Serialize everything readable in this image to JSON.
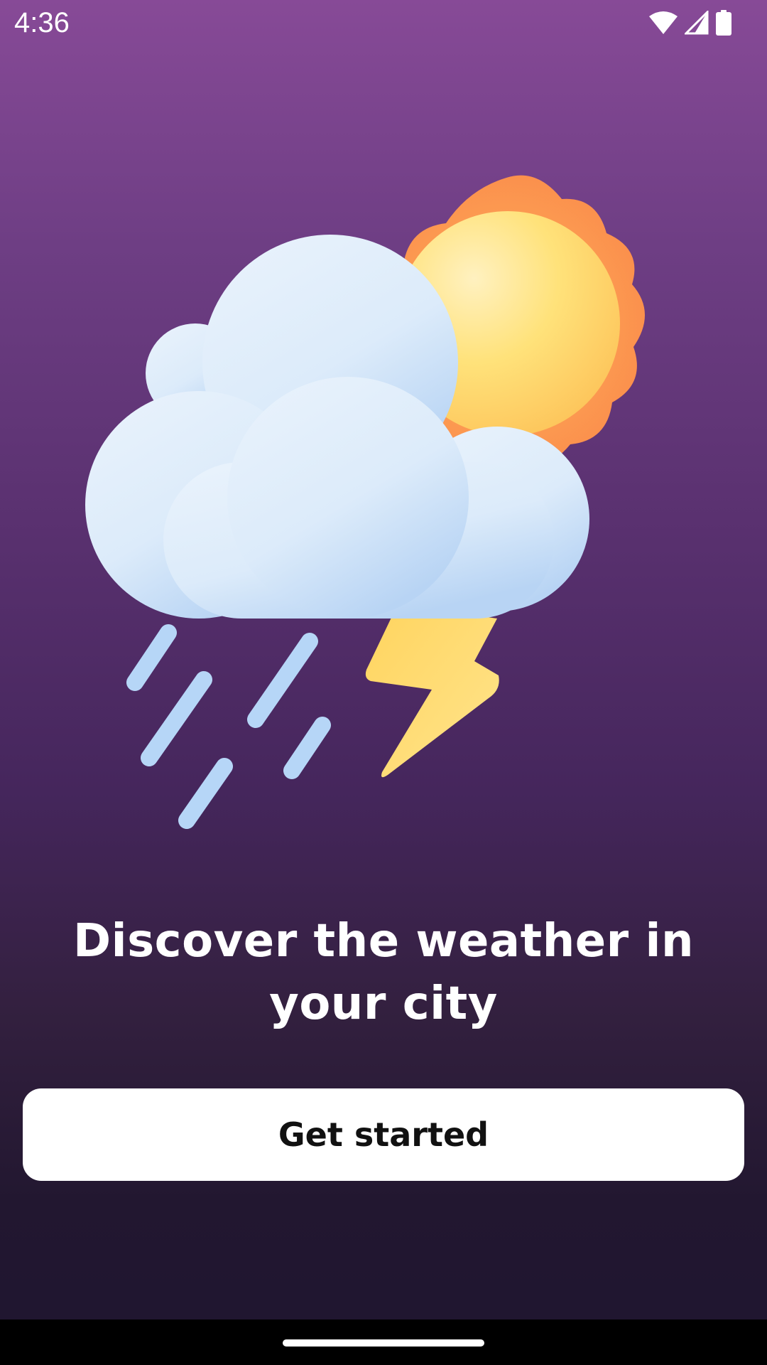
{
  "status_bar": {
    "time": "4:36",
    "icons": [
      "wifi-icon",
      "cellular-signal-icon",
      "battery-icon"
    ]
  },
  "illustration": {
    "icon": "weather-cloud-sun-thunder-rain-icon",
    "colors": {
      "cloud": "#DCEBFA",
      "sun_core": "#FFE27A",
      "sun_rays": "#FB9B4F",
      "lightning": "#FFD45E",
      "rain": "#B6D6F7"
    }
  },
  "onboarding": {
    "headline": "Discover the weather in your city",
    "cta_label": "Get started"
  },
  "theme": {
    "gradient_top": "#874A97",
    "gradient_bottom": "#1F1530",
    "button_bg": "#FFFFFF",
    "button_text": "#111111"
  }
}
